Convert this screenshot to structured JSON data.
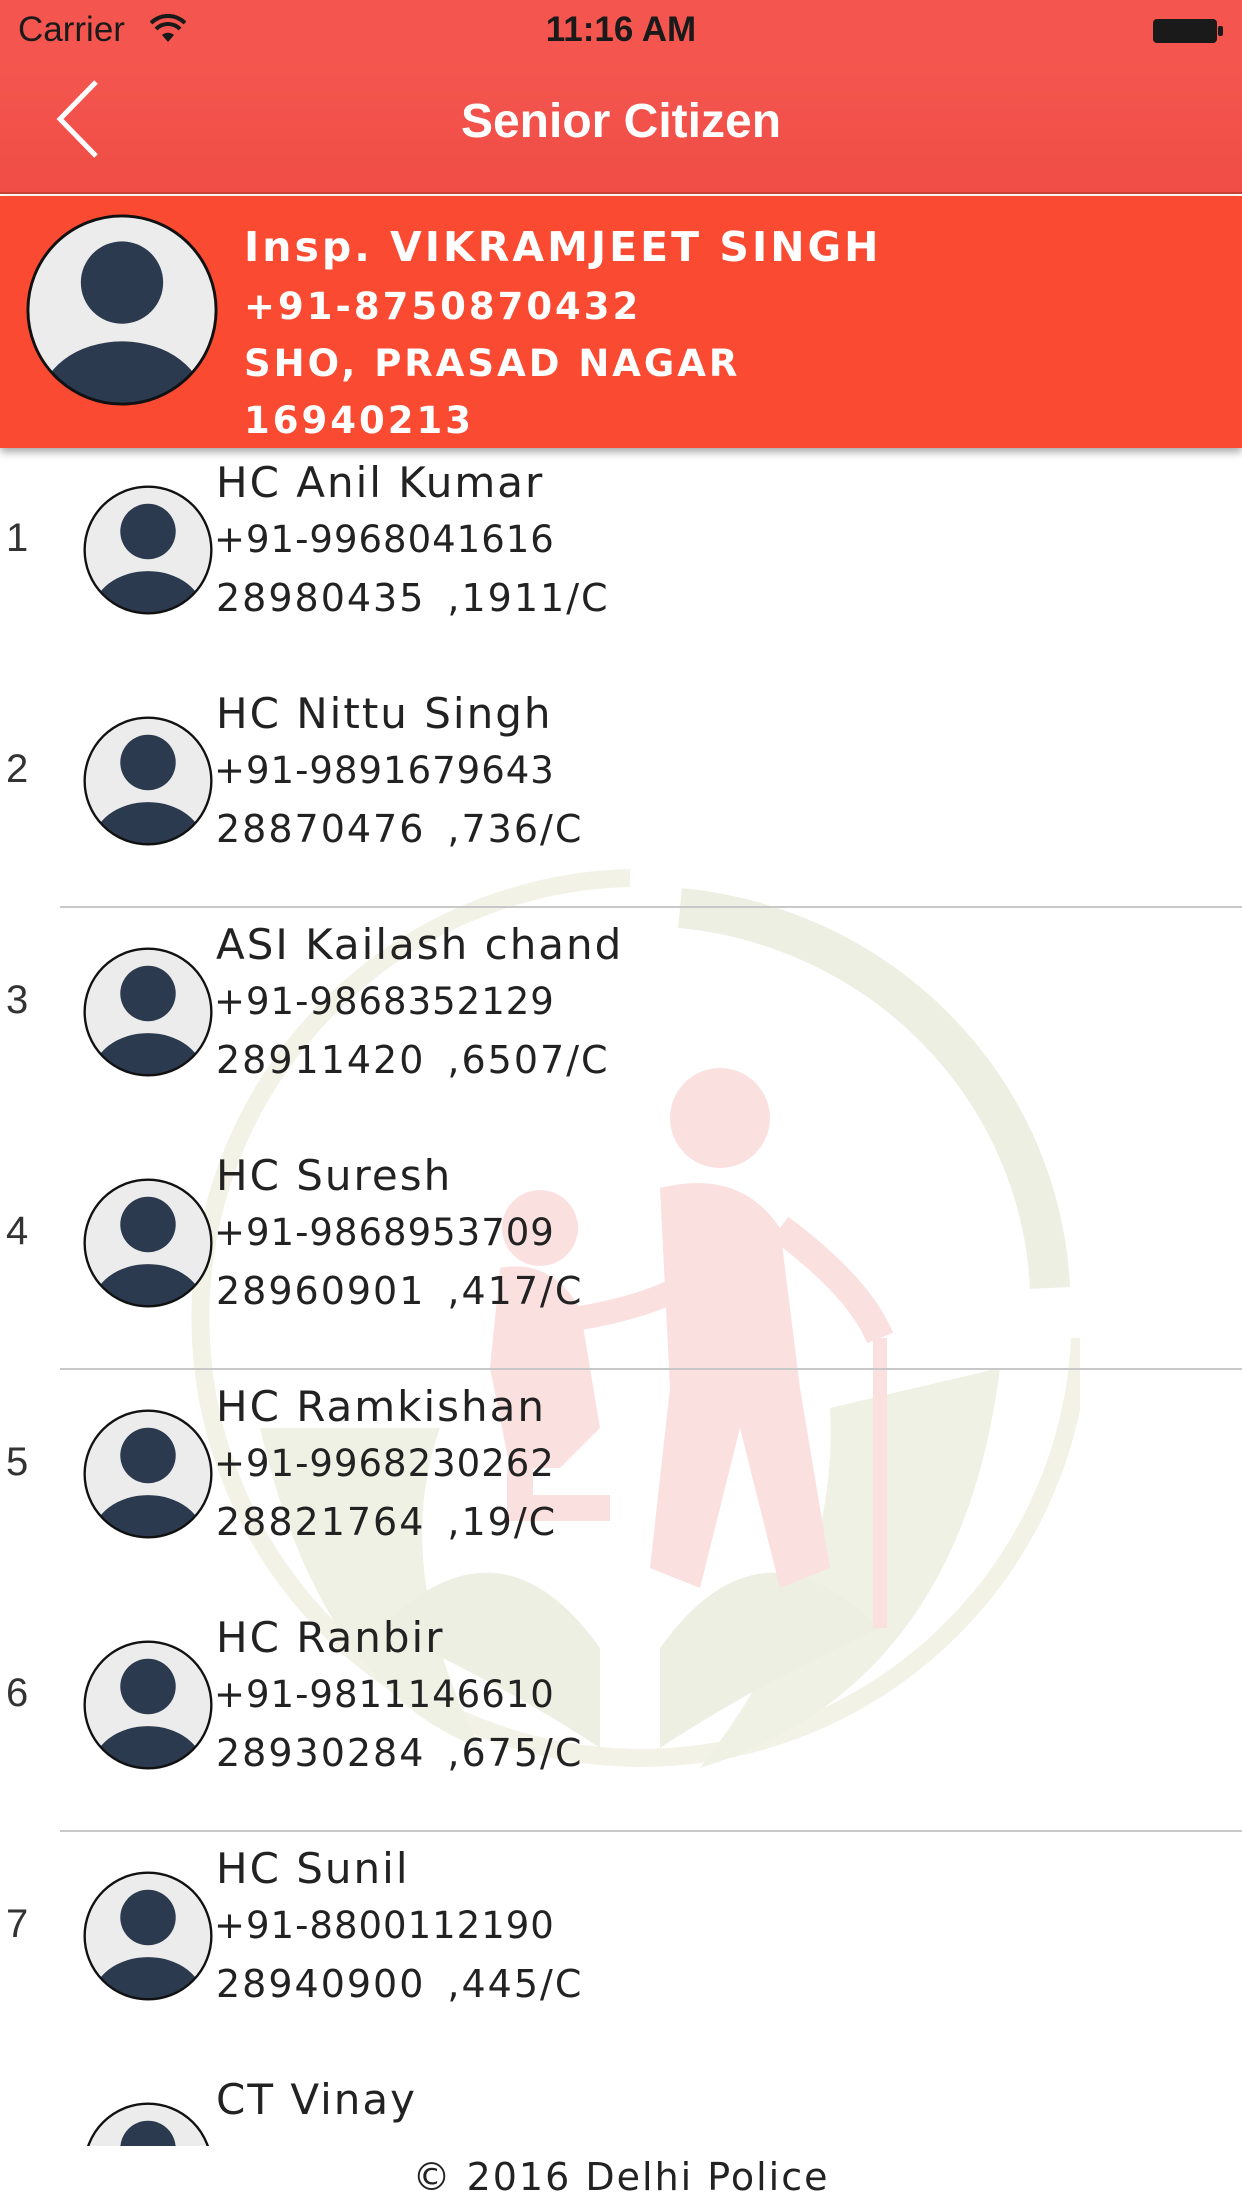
{
  "status_bar": {
    "carrier": "Carrier",
    "time": "11:16 AM"
  },
  "nav": {
    "title": "Senior Citizen"
  },
  "officer": {
    "name": "Insp. VIKRAMJEET SINGH",
    "phone": "+91-8750870432",
    "post": "SHO, PRASAD NAGAR",
    "number": "16940213"
  },
  "contacts": [
    {
      "index": "1",
      "name": "HC Anil Kumar",
      "phone": "+91-9968041616",
      "id": "28980435",
      "suffix": ",1911/C"
    },
    {
      "index": "2",
      "name": "HC Nittu Singh",
      "phone": "+91-9891679643",
      "id": "28870476",
      "suffix": ",736/C"
    },
    {
      "index": "3",
      "name": "ASI  Kailash chand",
      "phone": "+91-9868352129",
      "id": "28911420",
      "suffix": ",6507/C"
    },
    {
      "index": "4",
      "name": "HC Suresh",
      "phone": "+91-9868953709",
      "id": "28960901",
      "suffix": ",417/C"
    },
    {
      "index": "5",
      "name": "HC Ramkishan",
      "phone": "+91-9968230262",
      "id": "28821764",
      "suffix": ",19/C"
    },
    {
      "index": "6",
      "name": "HC Ranbir",
      "phone": "+91-9811146610",
      "id": "28930284",
      "suffix": ",675/C"
    },
    {
      "index": "7",
      "name": "HC Sunil",
      "phone": "+91-8800112190",
      "id": "28940900",
      "suffix": ",445/C"
    },
    {
      "index": "",
      "name": "CT Vinay",
      "phone": "",
      "id": "",
      "suffix": ""
    }
  ],
  "footer": {
    "text": "© 2016 Delhi Police"
  },
  "colors": {
    "header": "#f4564f",
    "officer_card": "#fa4a31",
    "avatar_fill": "#2b3a4e"
  }
}
